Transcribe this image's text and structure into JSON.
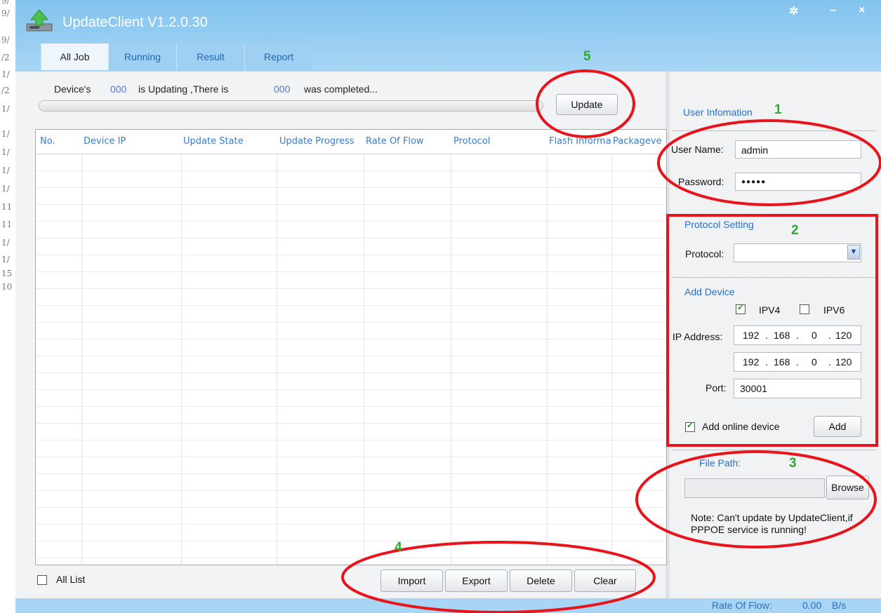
{
  "bg_strip": [
    "9/",
    "9/",
    "9/",
    "/2",
    "1/",
    "/2",
    "1/",
    "1/",
    "1/",
    "1/",
    "1/",
    "11",
    "11",
    "1/",
    "1/",
    "15",
    "10"
  ],
  "window": {
    "title": "UpdateClient V1.2.0.30",
    "controls": {
      "settings": "✲",
      "minimize": "–",
      "close": "×"
    }
  },
  "tabs": [
    {
      "label": "All Job",
      "active": true
    },
    {
      "label": "Running",
      "active": false
    },
    {
      "label": "Result",
      "active": false
    },
    {
      "label": "Report",
      "active": false
    }
  ],
  "status": {
    "prefix": "Device's",
    "updating_count": "000",
    "middle": "is Updating ,There is",
    "completed_count": "000",
    "suffix": "was completed...",
    "progress": 0
  },
  "update_button": "Update",
  "table": {
    "columns": [
      "No.",
      "Device IP",
      "Update State",
      "Update Progress",
      "Rate Of Flow",
      "Protocol",
      "Flash Informa",
      "Packageve"
    ],
    "rows": []
  },
  "all_list_label": "All List",
  "all_list_checked": false,
  "actions": {
    "import": "Import",
    "export": "Export",
    "delete": "Delete",
    "clear": "Clear"
  },
  "user_info": {
    "title": "User Infomation",
    "username_label": "User Name:",
    "username": "admin",
    "password_label": "Password:",
    "password_mask": "●●●●●"
  },
  "protocol_setting": {
    "title": "Protocol Setting",
    "protocol_label": "Protocol:",
    "protocol_value": ""
  },
  "add_device": {
    "title": "Add Device",
    "ipv4_label": "IPV4",
    "ipv4_checked": true,
    "ipv6_label": "IPV6",
    "ipv6_checked": false,
    "ip_label": "IP Address:",
    "ip_start": [
      "192",
      "168",
      "0",
      "120"
    ],
    "ip_end": [
      "192",
      "168",
      "0",
      "120"
    ],
    "port_label": "Port:",
    "port": "30001",
    "online_label": "Add online device",
    "online_checked": true,
    "add_button": "Add"
  },
  "file_path": {
    "title": "File Path:",
    "value": "",
    "browse_button": "Browse",
    "note": "Note: Can't update by UpdateClient,if PPPOE service is running!"
  },
  "status_bar": {
    "rate_label": "Rate Of Flow:",
    "rate_value": "0.00",
    "rate_unit": "B/s"
  },
  "annotations": {
    "n1": "1",
    "n2": "2",
    "n3": "3",
    "n4": "4",
    "n5": "5"
  },
  "colors": {
    "accent": "#2b6fc8",
    "title_bar": "#8cc8ef",
    "annotation_red": "#e8141c",
    "annotation_green": "#2eaa2e"
  }
}
